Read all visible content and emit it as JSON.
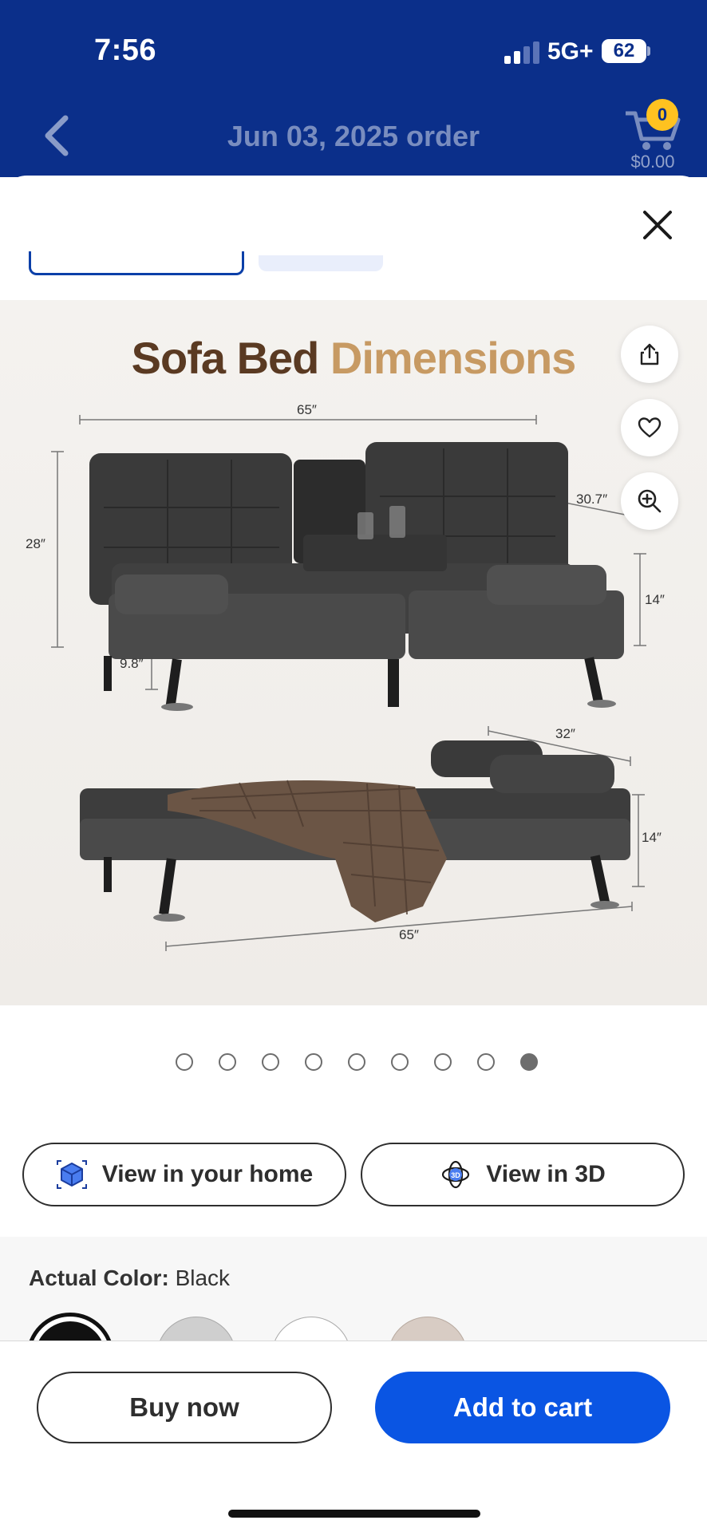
{
  "status_bar": {
    "time": "7:56",
    "network": "5G+",
    "battery": "62"
  },
  "nav": {
    "title": "Jun 03, 2025 order",
    "cart_count": "0",
    "cart_total": "$0.00"
  },
  "product_image": {
    "title_part1": "Sofa Bed",
    "title_part2": "Dimensions",
    "dimensions": {
      "sofa_width": "65″",
      "sofa_height": "28″",
      "arm_depth": "30.7″",
      "seat_height": "14″",
      "leg_height": "9.8″",
      "bed_depth": "32″",
      "bed_height": "14″",
      "bed_width": "65″"
    }
  },
  "carousel": {
    "total": 9,
    "active_index": 8
  },
  "view_buttons": {
    "home_label": "View in your home",
    "threed_label": "View in 3D"
  },
  "color": {
    "label": "Actual Color:",
    "value": "Black"
  },
  "actions": {
    "buy_now": "Buy now",
    "add_to_cart": "Add to cart"
  },
  "colors": {
    "brand_blue": "#0b2f8a",
    "cta_blue": "#0a55e3",
    "badge_yellow": "#ffc220"
  }
}
